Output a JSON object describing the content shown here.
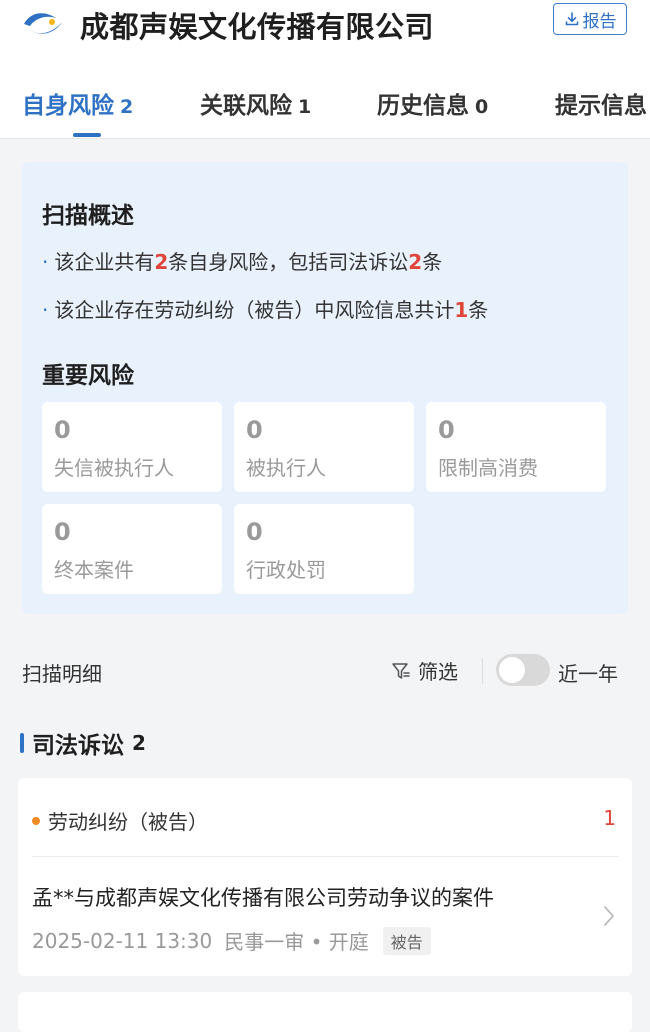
{
  "header": {
    "title": "成都声娱文化传播有限公司",
    "report_label": "报告",
    "accent": "#2f72c4"
  },
  "tabs": [
    {
      "label": "自身风险",
      "count": "2",
      "active": true
    },
    {
      "label": "关联风险",
      "count": "1"
    },
    {
      "label": "历史信息",
      "count": "0"
    },
    {
      "label": "提示信息"
    }
  ],
  "scan": {
    "title": "扫描概述",
    "lines": [
      {
        "p1": "该企业共有",
        "n1": "2",
        "p2": "条自身风险，包括司法诉讼",
        "n2": "2",
        "p3": "条"
      },
      {
        "p1": "该企业存在劳动纠纷（被告）中风险信息共计",
        "n1": "1",
        "p2": "条"
      }
    ],
    "important_title": "重要风险",
    "risks": [
      {
        "value": "0",
        "label": "失信被执行人"
      },
      {
        "value": "0",
        "label": "被执行人"
      },
      {
        "value": "0",
        "label": "限制高消费"
      },
      {
        "value": "0",
        "label": "终本案件"
      },
      {
        "value": "0",
        "label": "行政处罚"
      }
    ]
  },
  "detail": {
    "label": "扫描明细",
    "filter_label": "筛选",
    "year_toggle_label": "近一年",
    "year_toggle_on": false
  },
  "judicial": {
    "title": "司法诉讼",
    "count": "2",
    "category": "劳动纠纷（被告）",
    "category_count": "1",
    "case_title": "孟**与成都声娱文化传播有限公司劳动争议的案件",
    "case_date": "2025-02-11 13:30",
    "case_type": "民事一审 • 开庭",
    "case_role": "被告"
  }
}
